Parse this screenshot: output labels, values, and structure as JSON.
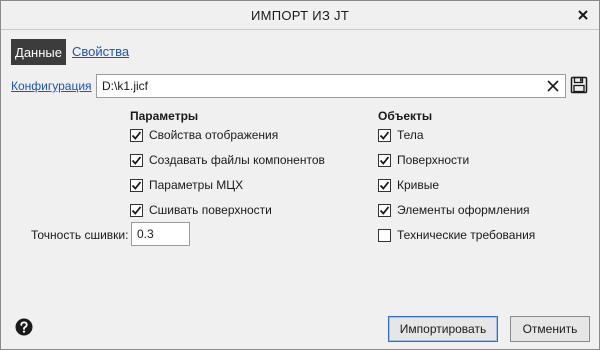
{
  "window": {
    "title": "ИМПОРТ ИЗ JT"
  },
  "tabs": [
    {
      "label": "Данные",
      "active": true
    },
    {
      "label": "Свойства",
      "active": false
    }
  ],
  "configuration": {
    "label": "Конфигурация",
    "value": "D:\\k1.jicf"
  },
  "parameters": {
    "title": "Параметры",
    "items": [
      {
        "label": "Свойства отображения",
        "checked": true
      },
      {
        "label": "Создавать файлы компонентов",
        "checked": true
      },
      {
        "label": "Параметры МЦХ",
        "checked": true
      },
      {
        "label": "Сшивать поверхности",
        "checked": true
      }
    ]
  },
  "objects": {
    "title": "Объекты",
    "items": [
      {
        "label": "Тела",
        "checked": true
      },
      {
        "label": "Поверхности",
        "checked": true
      },
      {
        "label": "Кривые",
        "checked": true
      },
      {
        "label": "Элементы оформления",
        "checked": true
      },
      {
        "label": "Технические требования",
        "checked": false
      }
    ]
  },
  "precision": {
    "label": "Точность сшивки:",
    "value": "0.3"
  },
  "buttons": {
    "import": "Импортировать",
    "cancel": "Отменить"
  },
  "icons": {
    "close": "close-icon",
    "clear": "clear-icon",
    "save": "save-icon",
    "help": "help-icon",
    "check": "checkmark-icon"
  },
  "colors": {
    "link": "#1a56b8",
    "active_tab": "#3c3c3c",
    "primary_border": "#2f6fbf"
  }
}
